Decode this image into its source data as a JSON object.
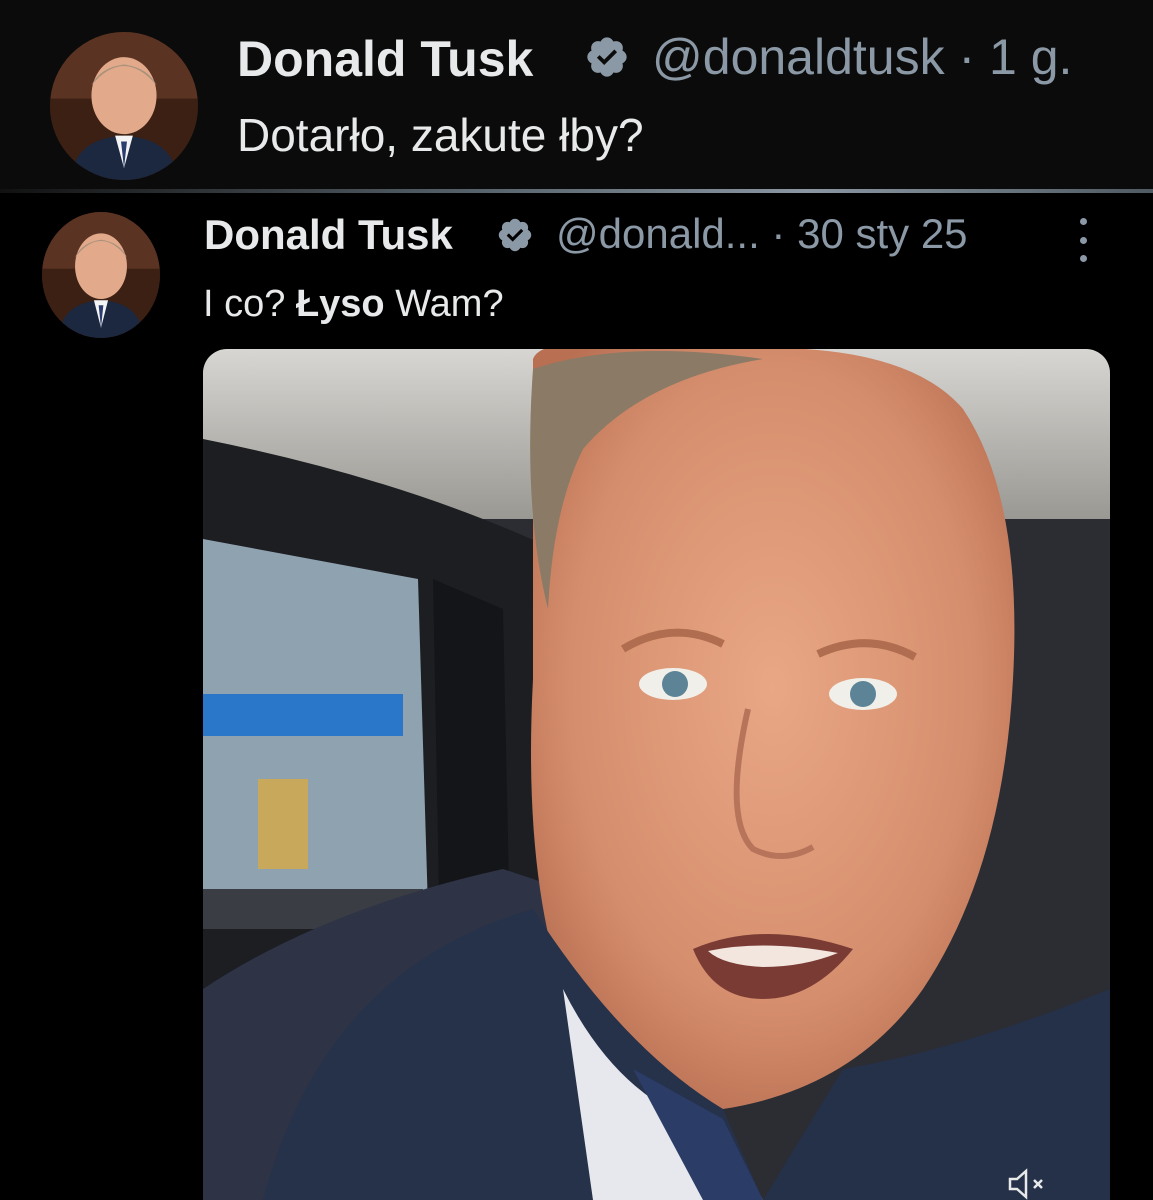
{
  "tweet": {
    "author_name": "Donald Tusk",
    "handle": "@donaldtusk",
    "time": "1 g.",
    "text": "Dotarło, zakute łby?"
  },
  "quoted_tweet": {
    "author_name": "Donald Tusk",
    "handle": "@donald...",
    "date": "30 sty 25",
    "text_before": "I co? ",
    "text_bold": "Łyso",
    "text_after": " Wam?"
  },
  "icons": {
    "verified": "verified-badge-icon",
    "menu": "more-options-icon",
    "mute": "volume-muted-icon"
  },
  "colors": {
    "background": "#000000",
    "text_primary": "#e7e9ea",
    "text_secondary": "#8b98a5",
    "verified": "#8b98a5"
  }
}
